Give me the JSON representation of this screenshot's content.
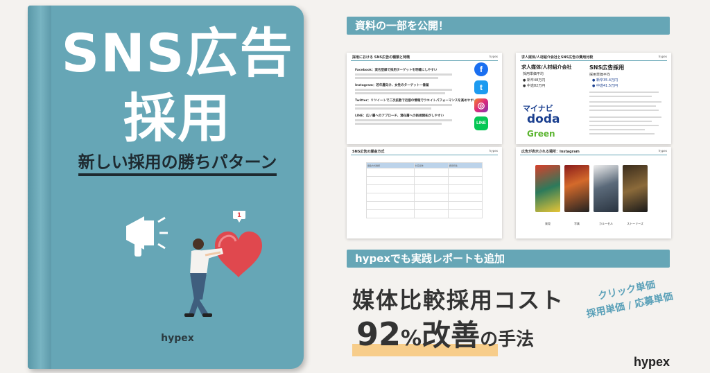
{
  "book": {
    "title_line1": "SNS広告",
    "title_line2": "採用",
    "subtitle": "新しい採用の勝ちパターン",
    "brand": "hypex",
    "notification_count": "1"
  },
  "banners": {
    "top": "資料の一部を公開！",
    "mid": "hypexでも実践レポートも追加"
  },
  "slides": {
    "s1": {
      "title": "採用における SNS広告の種類と特徴",
      "brand": "hypex",
      "headings": [
        "Facebook：実名登録で採用ターゲットを明確にしやすい",
        "Instagram：若年層向け、女性のターゲット一番着",
        "Twitter：リツイートで二次拡散で近接の情報でウエイトパフォーマンスを高めやすい",
        "LINE：広い層へのアプローチ、潜在層への新規開拓がしやすい"
      ],
      "social": [
        "f",
        "t",
        "◎",
        "LINE"
      ]
    },
    "s2": {
      "title": "求人媒体/人材紹介会社とSNS広告の費用比較",
      "brand": "hypex",
      "left_head": "求人媒体/人材紹介会社",
      "left_sub": "採用単価平均",
      "left_items": [
        "● 新卒48万円",
        "● 中途82万円"
      ],
      "right_head": "SNS広告採用",
      "right_sub": "採用単価平均",
      "right_items": [
        "● 新卒35.4万円",
        "● 中途41.5万円"
      ],
      "logos": [
        "マイナビ",
        "doda",
        "Green"
      ]
    },
    "s3": {
      "title": "SNS広告の課金方式",
      "brand": "hypex",
      "headers": [
        "課金方式種類",
        "対応媒体",
        "費用特性"
      ]
    },
    "s4": {
      "title": "広告が表示される場所：Instagram",
      "brand": "hypex",
      "labels": [
        "発見",
        "写真",
        "カルーセル",
        "ストーリーズ"
      ]
    }
  },
  "bottom": {
    "cost_title": "媒体比較採用コスト",
    "number": "92",
    "percent": "%",
    "word": "改善",
    "tail": "の手法",
    "side_line1": "クリック単価",
    "side_line2": "採用単価 / 応募単価",
    "brand": "hypex"
  },
  "colors": {
    "book": "#66a6b6",
    "banner": "#66a6b6",
    "highlight": "#f7cd8a",
    "heart": "#e0484e",
    "accent_text": "#5aa0b8"
  }
}
